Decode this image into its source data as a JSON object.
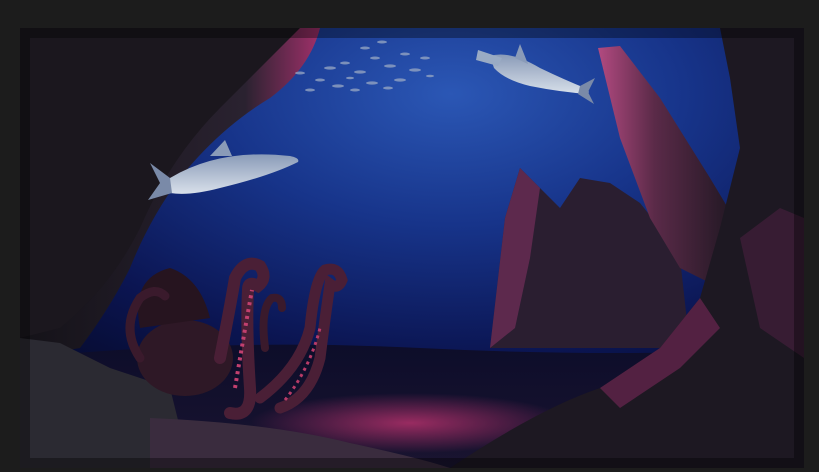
{
  "scene": {
    "description_colors": {
      "frame": "#1c1c1c",
      "water_top": "#1b3f8f",
      "water_mid": "#0f2166",
      "water_deep": "#070b2c",
      "rock_dark": "#1e1a22",
      "rock_highlight": "#b03a78",
      "octopus": "#3a1a2c",
      "octopus_suckers": "#c2406f",
      "sand_glow": "#7a2350"
    },
    "elements": [
      "school-of-fish",
      "hammerhead-shark",
      "reef-shark",
      "octopus",
      "left-rock-arch",
      "right-rock-spire",
      "background-rock-formation",
      "seafloor"
    ]
  }
}
